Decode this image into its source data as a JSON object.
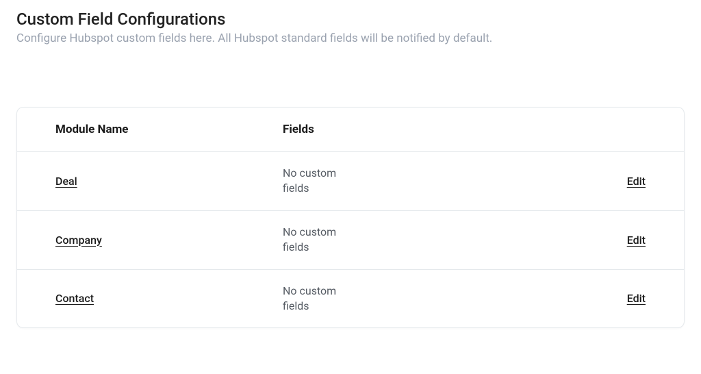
{
  "header": {
    "title": "Custom Field Configurations",
    "subtitle": "Configure Hubspot custom fields here. All Hubspot standard fields will be notified by default."
  },
  "table": {
    "headers": {
      "module": "Module Name",
      "fields": "Fields",
      "actions": ""
    },
    "rows": [
      {
        "module": "Deal",
        "fields": "No custom fields",
        "action": "Edit"
      },
      {
        "module": "Company",
        "fields": "No custom fields",
        "action": "Edit"
      },
      {
        "module": "Contact",
        "fields": "No custom fields",
        "action": "Edit"
      }
    ]
  }
}
